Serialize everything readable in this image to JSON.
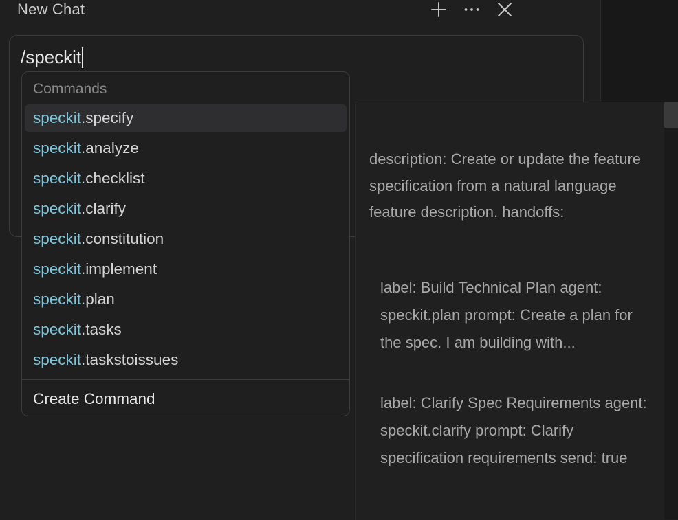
{
  "header": {
    "title": "New Chat",
    "actions": [
      {
        "icon": "plus-icon",
        "label": "+"
      },
      {
        "icon": "more-icon",
        "label": "···"
      },
      {
        "icon": "close-icon",
        "label": "×"
      }
    ]
  },
  "input": {
    "value": "/speckit"
  },
  "commands": {
    "header": "Commands",
    "highlight_prefix": "speckit",
    "items": [
      {
        "prefix": "speckit",
        "suffix": ".specify",
        "selected": true
      },
      {
        "prefix": "speckit",
        "suffix": ".analyze",
        "selected": false
      },
      {
        "prefix": "speckit",
        "suffix": ".checklist",
        "selected": false
      },
      {
        "prefix": "speckit",
        "suffix": ".clarify",
        "selected": false
      },
      {
        "prefix": "speckit",
        "suffix": ".constitution",
        "selected": false
      },
      {
        "prefix": "speckit",
        "suffix": ".implement",
        "selected": false
      },
      {
        "prefix": "speckit",
        "suffix": ".plan",
        "selected": false
      },
      {
        "prefix": "speckit",
        "suffix": ".tasks",
        "selected": false
      },
      {
        "prefix": "speckit",
        "suffix": ".taskstoissues",
        "selected": false
      }
    ],
    "create_label": "Create Command"
  },
  "detail": {
    "description": "description: Create or update the feature specification from a natural language feature description. handoffs:",
    "handoffs": [
      "label: Build Technical Plan agent: speckit.plan prompt: Create a plan for the spec. I am building with...",
      "label: Clarify Spec Requirements agent: speckit.clarify prompt: Clarify specification requirements send: true"
    ]
  },
  "colors": {
    "background": "#1f1f1f",
    "highlight": "#7dc6dc",
    "selected_row": "#2e2e30",
    "border": "#3c3c3c"
  }
}
